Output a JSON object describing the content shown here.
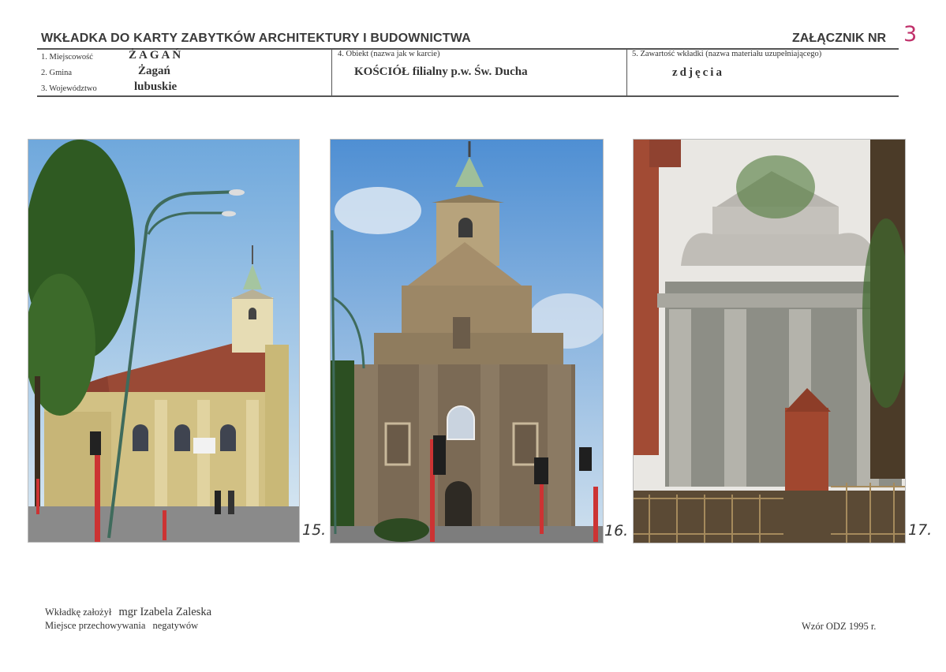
{
  "header": {
    "title": "WKŁADKA DO KARTY ZABYTKÓW ARCHITEKTURY I BUDOWNICTWA",
    "annex_label": "ZAŁĄCZNIK NR",
    "annex_number": "3"
  },
  "fields": {
    "locality_label": "1. Miejscowość",
    "locality_value": "ŻAGAŃ",
    "commune_label": "2. Gmina",
    "commune_value": "Żagań",
    "voivodeship_label": "3. Województwo",
    "voivodeship_value": "lubuskie",
    "object_label": "4. Obiekt (nazwa jak w karcie)",
    "object_value": "KOŚCIÓŁ filialny p.w. Św. Ducha",
    "content_label": "5. Zawartość wkładki (nazwa materiału uzupełniającego)",
    "content_value": "zdjęcia"
  },
  "photos": [
    {
      "number": "15."
    },
    {
      "number": "16."
    },
    {
      "number": "17."
    }
  ],
  "footer": {
    "author_label": "Wkładkę założył",
    "author_name": "mgr Izabela Zaleska",
    "storage_label": "Miejsce przechowywania",
    "storage_value": "negatywów",
    "template": "Wzór ODZ 1995 r."
  },
  "colors": {
    "annex_ink": "#c0306a",
    "rule": "#555555"
  }
}
